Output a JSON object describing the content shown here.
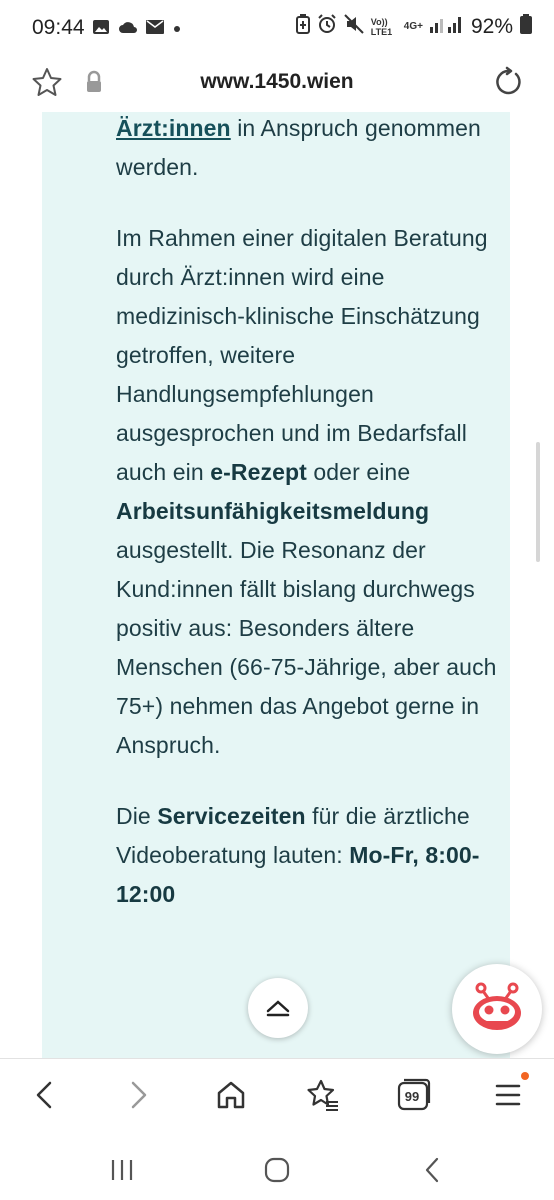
{
  "status_bar": {
    "time": "09:44",
    "network_label": "Vo)) LTE1",
    "network_type": "4G+",
    "battery": "92%",
    "left_icons": [
      "image-icon",
      "cloud-icon",
      "mail-icon",
      "dot-icon"
    ],
    "right_icons": [
      "battery-saver-icon",
      "alarm-icon",
      "mute-icon",
      "signal-icon"
    ]
  },
  "url_bar": {
    "url": "www.1450.wien"
  },
  "article": {
    "p1_link": "Ärzt:innen",
    "p1_rest": " in Anspruch genommen werden.",
    "p2_a": "Im Rahmen einer digitalen Beratung durch Ärzt:innen wird eine medizinisch-klinische Einschätzung getroffen, weitere Handlungsempfehlungen ausgesprochen und im Bedarfsfall auch ein ",
    "p2_b1": "e-Rezept",
    "p2_c": " oder eine ",
    "p2_b2": "Arbeitsunfähigkeitsmeldung",
    "p2_d": " ausgestellt. Die Resonanz der Kund:innen fällt bislang durchwegs positiv aus: Besonders ältere Menschen (66-75-Jährige, aber auch 75+) nehmen das Angebot gerne in Anspruch.",
    "p3_a": "Die ",
    "p3_b1": "Servicezeiten",
    "p3_c": " für die ärztliche Videoberatung lauten: ",
    "p3_b2": "Mo-Fr, 8:00-12:00"
  },
  "toolbar": {
    "tabs_count": "99",
    "items": [
      "back-icon",
      "forward-icon",
      "home-icon",
      "bookmarks-icon",
      "tabs-icon",
      "menu-icon"
    ]
  },
  "colors": {
    "panel_bg": "#e6f6f5",
    "text": "#1e3d45",
    "link": "#16505a",
    "bot_accent": "#e8484f",
    "notification": "#f26522"
  }
}
